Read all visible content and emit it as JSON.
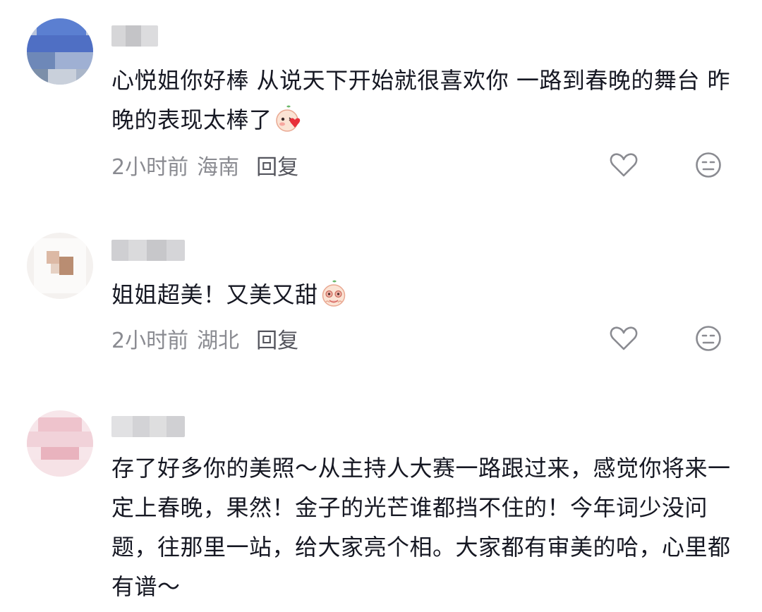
{
  "comments": [
    {
      "text": "心悦姐你好棒 从说天下开始就很喜欢你 一路到春晚的舞台 昨晚的表现太棒了",
      "time": "2小时前",
      "location": "海南",
      "reply_label": "回复",
      "emoji_icon": "kiss-heart-emoji-icon",
      "like_icon": "heart-outline-icon",
      "dislike_icon": "neutral-face-icon"
    },
    {
      "text": "姐姐超美！又美又甜",
      "time": "2小时前",
      "location": "湖北",
      "reply_label": "回复",
      "emoji_icon": "starry-eyes-emoji-icon",
      "like_icon": "heart-outline-icon",
      "dislike_icon": "neutral-face-icon"
    },
    {
      "text": "存了好多你的美照～从主持人大赛一路跟过来，感觉你将来一定上春晚，果然！金子的光芒谁都挡不住的！今年词少没问题，往那里一站，给大家亮个相。大家都有审美的哈，心里都有谱～"
    }
  ],
  "colors": {
    "text": "#161823",
    "meta": "#8a8b91",
    "reply": "#54555d",
    "icon": "#8a8b91"
  }
}
